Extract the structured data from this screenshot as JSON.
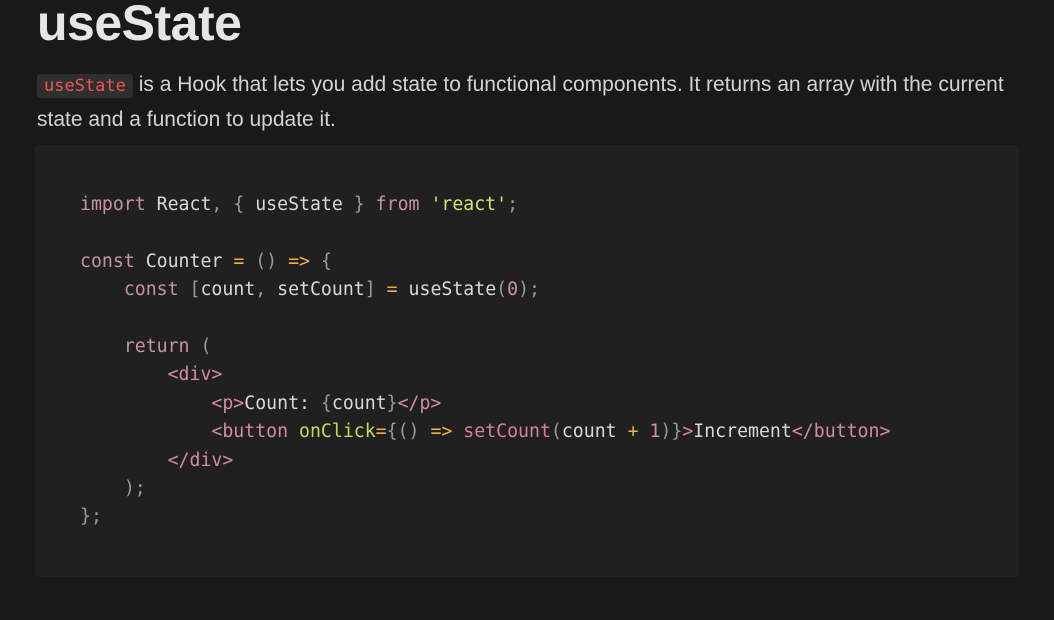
{
  "heading": {
    "title": "useState"
  },
  "description": {
    "inline_code": "useState",
    "text": " is a Hook that lets you add state to functional components. It returns an array with the current state and a function to update it."
  },
  "code_block": {
    "language": "jsx",
    "lines": [
      "import React, { useState } from 'react';",
      "",
      "const Counter = () => {",
      "    const [count, setCount] = useState(0);",
      "",
      "    return (",
      "        <div>",
      "            <p>Count: {count}</p>",
      "            <button onClick={() => setCount(count + 1)}>Increment</button>",
      "        </div>",
      "    );",
      "};"
    ]
  },
  "colors": {
    "background": "#191919",
    "code_background": "#202020",
    "inline_code_text": "#eb5757",
    "keyword": "#c9929f",
    "string": "#d2e56d",
    "operator": "#f0b04a"
  }
}
